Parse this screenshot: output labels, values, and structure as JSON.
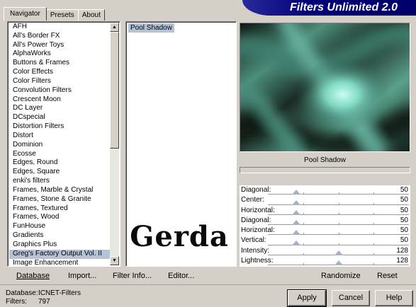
{
  "banner": {
    "title": "Filters Unlimited 2.0"
  },
  "tabs": [
    {
      "label": "Navigator",
      "active": true
    },
    {
      "label": "Presets",
      "active": false
    },
    {
      "label": "About",
      "active": false
    }
  ],
  "categories": {
    "items": [
      "AFH",
      "All's Border FX",
      "All's Power Toys",
      "AlphaWorks",
      "Buttons & Frames",
      "Color Effects",
      "Color Filters",
      "Convolution Filters",
      "Crescent Moon",
      "DC Layer",
      "DCspecial",
      "Distortion Filters",
      "Distort",
      "Dominion",
      "Ecosse",
      "Edges, Round",
      "Edges, Square",
      "enki's filters",
      "Frames, Marble & Crystal",
      "Frames, Stone & Granite",
      "Frames, Textured",
      "Frames, Wood",
      "FunHouse",
      "Gradients",
      "Graphics Plus",
      "Greg's Factory Output Vol. II",
      "Image Enhancement"
    ],
    "selected_index": 25
  },
  "filters": {
    "selected": "Pool Shadow",
    "logo_text": "Gerda"
  },
  "preview": {
    "label": "Pool Shadow"
  },
  "sliders": [
    {
      "label": "Diagonal:",
      "value": "50",
      "fraction": 0.2
    },
    {
      "label": "Center:",
      "value": "50",
      "fraction": 0.2
    },
    {
      "label": "Horizontal:",
      "value": "50",
      "fraction": 0.2
    },
    {
      "label": "Diagonal:",
      "value": "50",
      "fraction": 0.2
    },
    {
      "label": "Horizontal:",
      "value": "50",
      "fraction": 0.2
    },
    {
      "label": "Vertical:",
      "value": "50",
      "fraction": 0.2
    },
    {
      "label": "Intensity:",
      "value": "128",
      "fraction": 0.5
    },
    {
      "label": "Lightness:",
      "value": "128",
      "fraction": 0.5
    }
  ],
  "links": {
    "database": "Database",
    "import": "Import...",
    "filter_info": "Filter Info...",
    "editor": "Editor...",
    "randomize": "Randomize",
    "reset": "Reset"
  },
  "status": {
    "database_label": "Database:",
    "database_value": "ICNET-Filters",
    "filters_label": "Filters:",
    "filters_value": "797"
  },
  "buttons": {
    "apply": "Apply",
    "cancel": "Cancel",
    "help": "Help"
  },
  "icons": {
    "scroll_up": "arrow-up-icon",
    "scroll_down": "arrow-down-icon"
  },
  "colors": {
    "banner": "#00007a",
    "selection": "#b4c4d8",
    "preview_glow": "#a0e8d8"
  }
}
